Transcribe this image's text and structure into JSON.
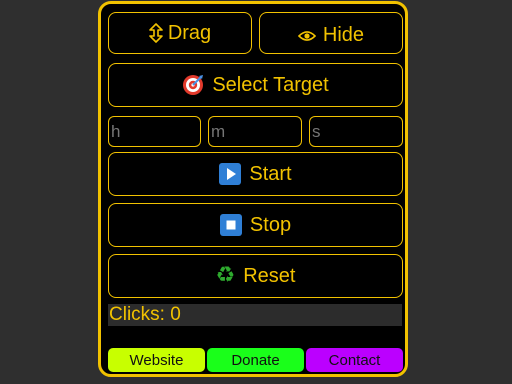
{
  "toolbar": {
    "drag_label": "Drag",
    "drag_icon": "up-down-arrow",
    "hide_label": "Hide",
    "hide_icon": "eye",
    "select_target_label": "Select Target",
    "select_target_icon": "target-dart"
  },
  "timer": {
    "hours_placeholder": "h",
    "minutes_placeholder": "m",
    "seconds_placeholder": "s"
  },
  "controls": {
    "start_label": "Start",
    "start_icon": "play-button",
    "stop_label": "Stop",
    "stop_icon": "stop-button",
    "reset_label": "Reset",
    "reset_icon": "recycle"
  },
  "status": {
    "clicks_text": "Clicks: 0"
  },
  "links": {
    "website_label": "Website",
    "donate_label": "Donate",
    "contact_label": "Contact"
  },
  "colors": {
    "accent": "#f2c200",
    "website": "#c8ff00",
    "donate": "#1aff1a",
    "contact": "#bb00ff"
  }
}
